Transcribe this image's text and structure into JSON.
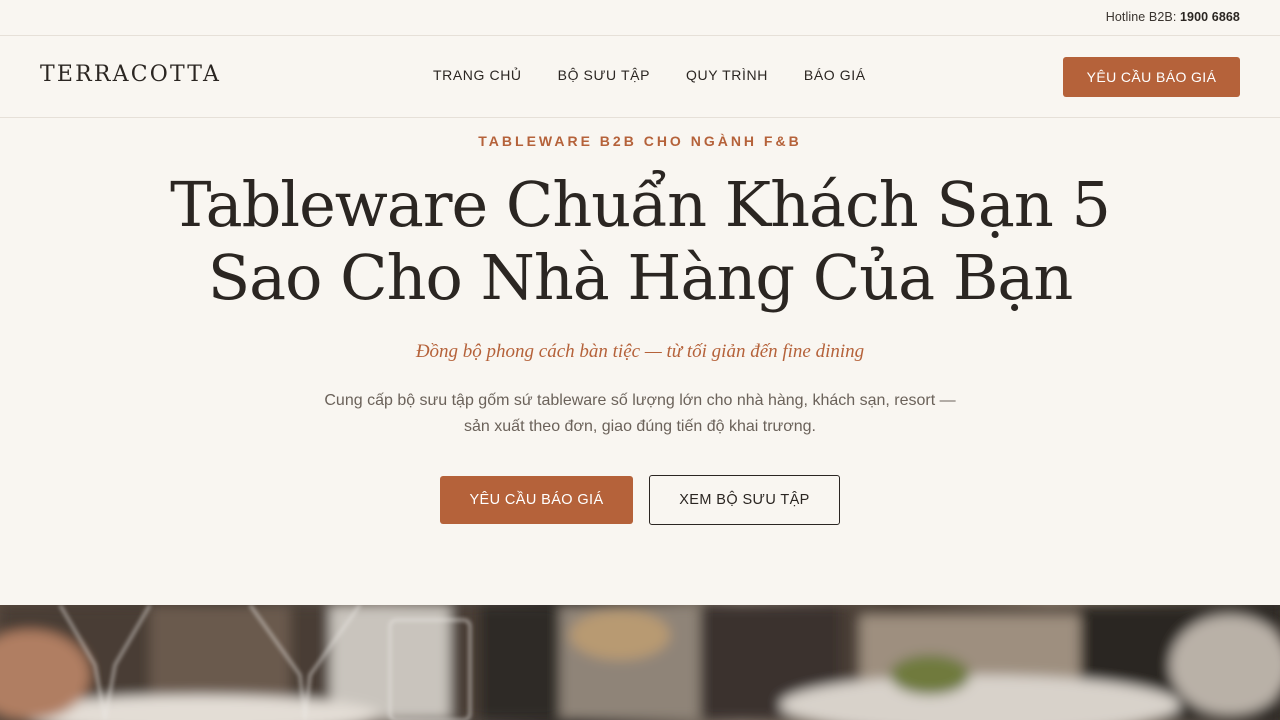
{
  "topbar": {
    "hotline_label": "Hotline B2B:",
    "hotline_number": "1900 6868"
  },
  "header": {
    "logo": "TERRACOTTA",
    "nav": [
      {
        "label": "TRANG CHỦ"
      },
      {
        "label": "BỘ SƯU TẬP"
      },
      {
        "label": "QUY TRÌNH"
      },
      {
        "label": "BÁO GIÁ"
      }
    ],
    "cta_label": "YÊU CẦU BÁO GIÁ"
  },
  "hero": {
    "eyebrow": "TABLEWARE B2B CHO NGÀNH F&B",
    "title_line1": "Tableware Chuẩn Khách Sạn 5",
    "title_line2": "Sao Cho Nhà Hàng Của Bạn",
    "tagline": "Đồng bộ phong cách bàn tiệc — từ tối giản đến fine dining",
    "description_line1": "Cung cấp bộ sưu tập gốm sứ tableware số lượng lớn cho nhà hàng, khách sạn, resort —",
    "description_line2": "sản xuất theo đơn, giao đúng tiến độ khai trương.",
    "primary_button": "YÊU CẦU BÁO GIÁ",
    "secondary_button": "XEM BỘ SƯU TẬP"
  },
  "colors": {
    "background": "#f9f6f1",
    "accent": "#b5623a",
    "text": "#2b2622",
    "muted": "#6b625a"
  }
}
